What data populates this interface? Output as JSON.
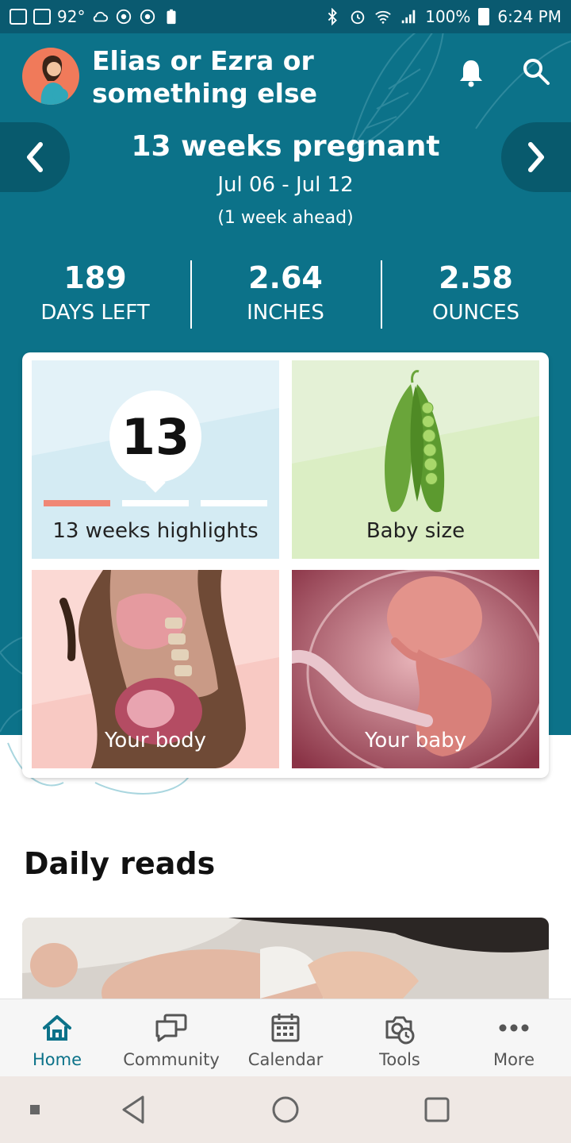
{
  "status_bar": {
    "temperature": "92°",
    "battery": "100%",
    "time": "6:24 PM"
  },
  "header": {
    "title": "Elias or Ezra or something else"
  },
  "week": {
    "title": "13 weeks pregnant",
    "dates": "Jul 06 - Jul 12",
    "ahead": "(1 week ahead)"
  },
  "stats": [
    {
      "value": "189",
      "label": "DAYS LEFT"
    },
    {
      "value": "2.64",
      "label": "INCHES"
    },
    {
      "value": "2.58",
      "label": "OUNCES"
    }
  ],
  "tiles": {
    "highlights": {
      "badge": "13",
      "label": "13 weeks highlights",
      "progress_active_segment": 1,
      "progress_segments": 3
    },
    "baby_size": {
      "label": "Baby size"
    },
    "your_body": {
      "label": "Your body"
    },
    "your_baby": {
      "label": "Your baby"
    }
  },
  "daily_reads": {
    "title": "Daily reads"
  },
  "tabbar": [
    {
      "label": "Home",
      "icon": "home-icon",
      "active": true
    },
    {
      "label": "Community",
      "icon": "chat-icon",
      "active": false
    },
    {
      "label": "Calendar",
      "icon": "calendar-icon",
      "active": false
    },
    {
      "label": "Tools",
      "icon": "tools-icon",
      "active": false
    },
    {
      "label": "More",
      "icon": "more-icon",
      "active": false
    }
  ],
  "colors": {
    "hero_bg": "#0c7289",
    "accent": "#0c7289",
    "progress_active": "#f08775"
  }
}
